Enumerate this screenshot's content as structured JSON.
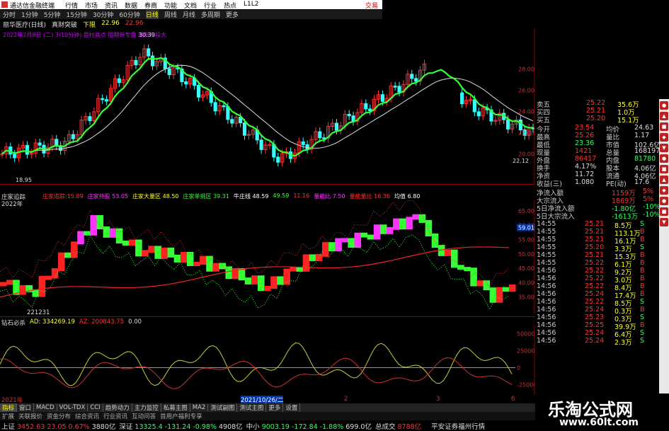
{
  "app": {
    "title": "通达信金融终端",
    "menus": [
      "行情",
      "市场",
      "资讯",
      "数据",
      "券商",
      "功能",
      "文档",
      "行业",
      "热点",
      "L1L2"
    ],
    "login": "交易"
  },
  "periods": [
    "分时",
    "1分钟",
    "5分钟",
    "15分钟",
    "30分钟",
    "60分钟",
    "日线",
    "周线",
    "月线",
    "多周期",
    "更多"
  ],
  "periods_selected": "日线",
  "info": {
    "stock": "丽华医疗(日线)",
    "ind": "真财突破",
    "label1": "下限",
    "v1": "22.96",
    "v2": "22.96"
  },
  "magline": "2022年2月8日 (二) 3(10分钟) 盘柱高点 阻期新专盘 限新阶段大",
  "price_labels": {
    "high": "30.39",
    "low": "18.95",
    "low2": "22.12"
  },
  "price_axis": [
    "28.00",
    "26.00",
    "24.00",
    "22.00",
    "20.00"
  ],
  "sub1": {
    "name": "庄家追踪",
    "k1": "庄家追踪:15.89",
    "v1": "",
    "k2": "庄家持股",
    "v2": "53.05",
    "k3": "庄家大量区",
    "v3": "48.50",
    "k4": "庄家单挑区",
    "v4": "39.31",
    "k5": "牛庄线",
    "v5": "48.59",
    "k6": "49.59",
    "k7": "11.16",
    "k8": "量能比",
    "v8": "7.50",
    "k9": "量能量比",
    "v9": "16.36",
    "k10": "均值",
    "v10": "6.80",
    "year": "2022年",
    "date": "221231",
    "cur": "59.01"
  },
  "sub1_axis": [
    "65.00",
    "60.00",
    "55.00",
    "50.00",
    "45.00",
    "40.00",
    "35.00"
  ],
  "sub2": {
    "name": "钻石必杀",
    "ad": "AD: 334269.19",
    "az": "AZ: 200843.75",
    "num": "0.00"
  },
  "sub2_axis": [
    "50000",
    "25000",
    "0",
    "-25000"
  ],
  "time_labels": {
    "t1": "2021年",
    "t2": "2021/10/26/二",
    "t3": "2",
    "t4": "3",
    "t5": "6"
  },
  "tabs": [
    "指标",
    "窗口",
    "MACD",
    "VOL-TDX",
    "CCI",
    "趋势动力",
    "主力监控",
    "私募主图",
    "MA2",
    "测试副图",
    "测试主图",
    "更多",
    "设置"
  ],
  "tabs_active": "指标",
  "tabs2": [
    "扩展",
    "关联报价",
    "资金分布",
    "综合资讯",
    "行业资讯",
    "互动问答",
    "首用户福利专享"
  ],
  "status": [
    {
      "name": "上证",
      "v": "3452.63",
      "c": "23.05",
      "p": "0.67%",
      "a": "3880亿"
    },
    {
      "name": "深证",
      "v": "13325.4",
      "c": "-131.24",
      "p": "-0.98%",
      "a": "4908亿"
    },
    {
      "name": "中小",
      "v": "9003.19",
      "c": "-172.84",
      "p": "-1.88%",
      "a": "699.0亿"
    },
    {
      "name": "总成交",
      "v": "8788亿",
      "c": "",
      "p": "",
      "a": ""
    }
  ],
  "status_extra": "平安证券福州行情",
  "right_top": [
    {
      "k": "卖五",
      "v": "25.22",
      "n": "35.6万"
    },
    {
      "k": "买四",
      "v": "25.21",
      "n": "1.0万"
    },
    {
      "k": "买五",
      "v": "25.20",
      "n": "15.1万"
    }
  ],
  "right_quote": [
    [
      "今开",
      "23.54",
      "均价",
      "24.63"
    ],
    [
      "最高",
      "25.26",
      "量比",
      "1.17"
    ],
    [
      "最低",
      "23.36",
      "市值",
      "102.6亿"
    ],
    [
      "现量",
      "1421",
      "总量",
      "168197"
    ],
    [
      "外盘",
      "86417",
      "内盘",
      "81780"
    ],
    [
      "换手",
      "4.17%",
      "股本",
      "4.06亿"
    ],
    [
      "净资",
      "11.72",
      "流通",
      "4.06亿"
    ],
    [
      "收益(三)",
      "1.080",
      "PE(动)",
      "17.6"
    ]
  ],
  "right_flow": [
    [
      "净流入额",
      "1159万",
      "5%"
    ],
    [
      "大宗流入",
      "1869万",
      "5%"
    ],
    [
      "5日净流入额",
      "-1.80亿",
      "-10%"
    ],
    [
      "5日大宗流入",
      "-1613万",
      "-10%"
    ]
  ],
  "ticks": [
    [
      "14:55",
      "25.21",
      "8.5万",
      "S"
    ],
    [
      "14:55",
      "25.21",
      "113.1万",
      "B"
    ],
    [
      "14:55",
      "25.21",
      "16.1万",
      "B"
    ],
    [
      "14:55",
      "25.20",
      "3.3万",
      "S"
    ],
    [
      "14:55",
      "25.21",
      "15.3万",
      "B"
    ],
    [
      "14:55",
      "25.22",
      "6.1万",
      "B"
    ],
    [
      "14:56",
      "25.22",
      "9.2万",
      "B"
    ],
    [
      "14:56",
      "25.22",
      "3.0万",
      "B"
    ],
    [
      "14:56",
      "25.22",
      "8.4万",
      "B"
    ],
    [
      "14:56",
      "25.24",
      "17.4万",
      "B"
    ],
    [
      "14:56",
      "25.22",
      "8.5万",
      "S"
    ],
    [
      "14:56",
      "25.24",
      "0.3万",
      "B"
    ],
    [
      "14:56",
      "25.23",
      "0.3万",
      "S"
    ],
    [
      "14:56",
      "25.25",
      "39.9万",
      "B"
    ],
    [
      "14:56",
      "25.24",
      "6.4万",
      "S"
    ],
    [
      "14:56",
      "25.24",
      "2.3万",
      "S"
    ]
  ],
  "watermark": {
    "cn": "乐淘公式网",
    "url": "www.60lt.com"
  },
  "colors": {
    "up": "#ff3333",
    "down": "#33ff66",
    "magenta": "#ff33ff",
    "yellow": "#ffff00"
  }
}
